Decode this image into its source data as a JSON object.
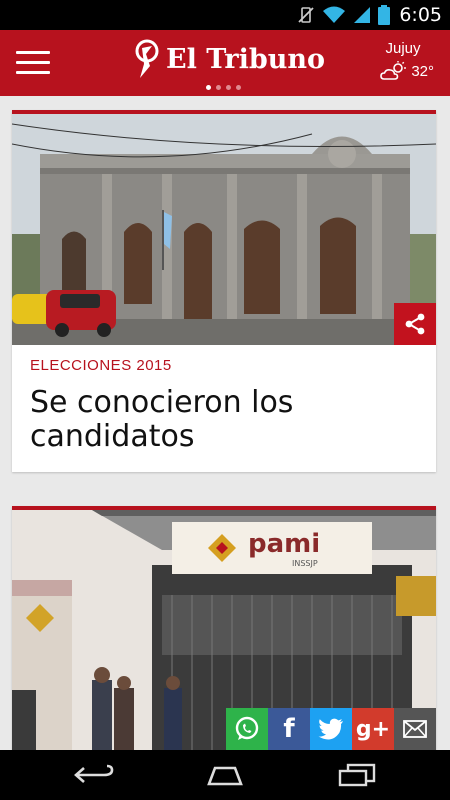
{
  "status_bar": {
    "time": "6:05",
    "icons": [
      "vibrate-off-icon",
      "wifi-icon",
      "signal-icon",
      "battery-icon"
    ]
  },
  "header": {
    "app_name": "El Tribuno",
    "pager_dots": 4,
    "active_dot": 0,
    "weather": {
      "city": "Jujuy",
      "temperature": "32°",
      "icon": "partly-cloudy-icon"
    }
  },
  "colors": {
    "brand_red": "#b7121e",
    "whatsapp": "#2eb34a",
    "facebook": "#3b5998",
    "twitter": "#1da1f2",
    "google_plus": "#d23b2c",
    "email": "#555555"
  },
  "articles": [
    {
      "category": "ELECCIONES 2015",
      "headline": "Se conocieron los candidatos",
      "image": "historic-building-photo",
      "share_icon": "share-icon"
    },
    {
      "image": "pami-building-photo",
      "image_sign_text": "pami",
      "image_sign_subtext": "INSSJP",
      "share_buttons": [
        {
          "name": "whatsapp",
          "label": ""
        },
        {
          "name": "facebook",
          "label": "f"
        },
        {
          "name": "twitter",
          "label": ""
        },
        {
          "name": "google-plus",
          "label": "g+"
        },
        {
          "name": "email",
          "label": ""
        }
      ]
    }
  ],
  "nav_bar": {
    "buttons": [
      "back-icon",
      "home-icon",
      "recent-apps-icon"
    ]
  }
}
